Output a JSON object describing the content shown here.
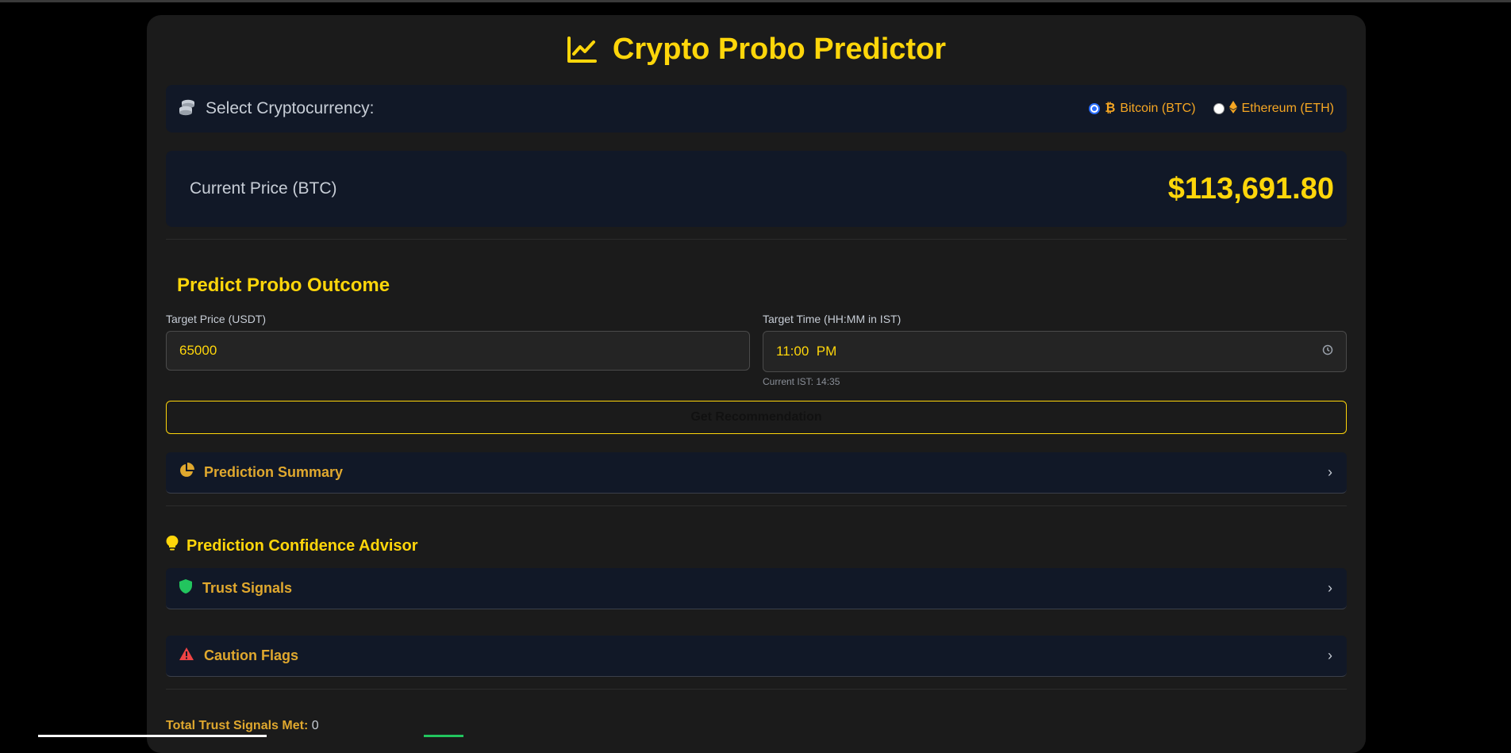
{
  "app": {
    "title": "Crypto Probo Predictor",
    "accent_color": "#ffd60a",
    "background_color": "#1b1b1b",
    "panel_color": "#111827"
  },
  "selector": {
    "label": "Select Cryptocurrency:",
    "options": [
      {
        "label": "Bitcoin (BTC)",
        "icon": "bitcoin-icon",
        "selected": true
      },
      {
        "label": "Ethereum (ETH)",
        "icon": "ethereum-icon",
        "selected": false
      }
    ]
  },
  "price": {
    "label": "Current Price (BTC)",
    "value": "$113,691.80"
  },
  "predict": {
    "title": "Predict Probo Outcome",
    "target_price_label": "Target Price (USDT)",
    "target_price_value": "65000",
    "target_time_label": "Target Time (HH:MM in IST)",
    "target_time_value": "11:00  PM",
    "current_ist": "Current IST: 14:35",
    "button_label": "Get Recommendation"
  },
  "summary": {
    "label": "Prediction Summary",
    "icon": "pie-chart-icon"
  },
  "advisor": {
    "title": "Prediction Confidence Advisor",
    "icon": "lightbulb-icon",
    "trust_label": "Trust Signals",
    "trust_icon": "shield-icon",
    "trust_color": "#22c55e",
    "caution_label": "Caution Flags",
    "caution_icon": "warning-icon",
    "caution_color": "#ef4444"
  },
  "totals": {
    "label": "Total Trust Signals Met:",
    "value": "0"
  }
}
